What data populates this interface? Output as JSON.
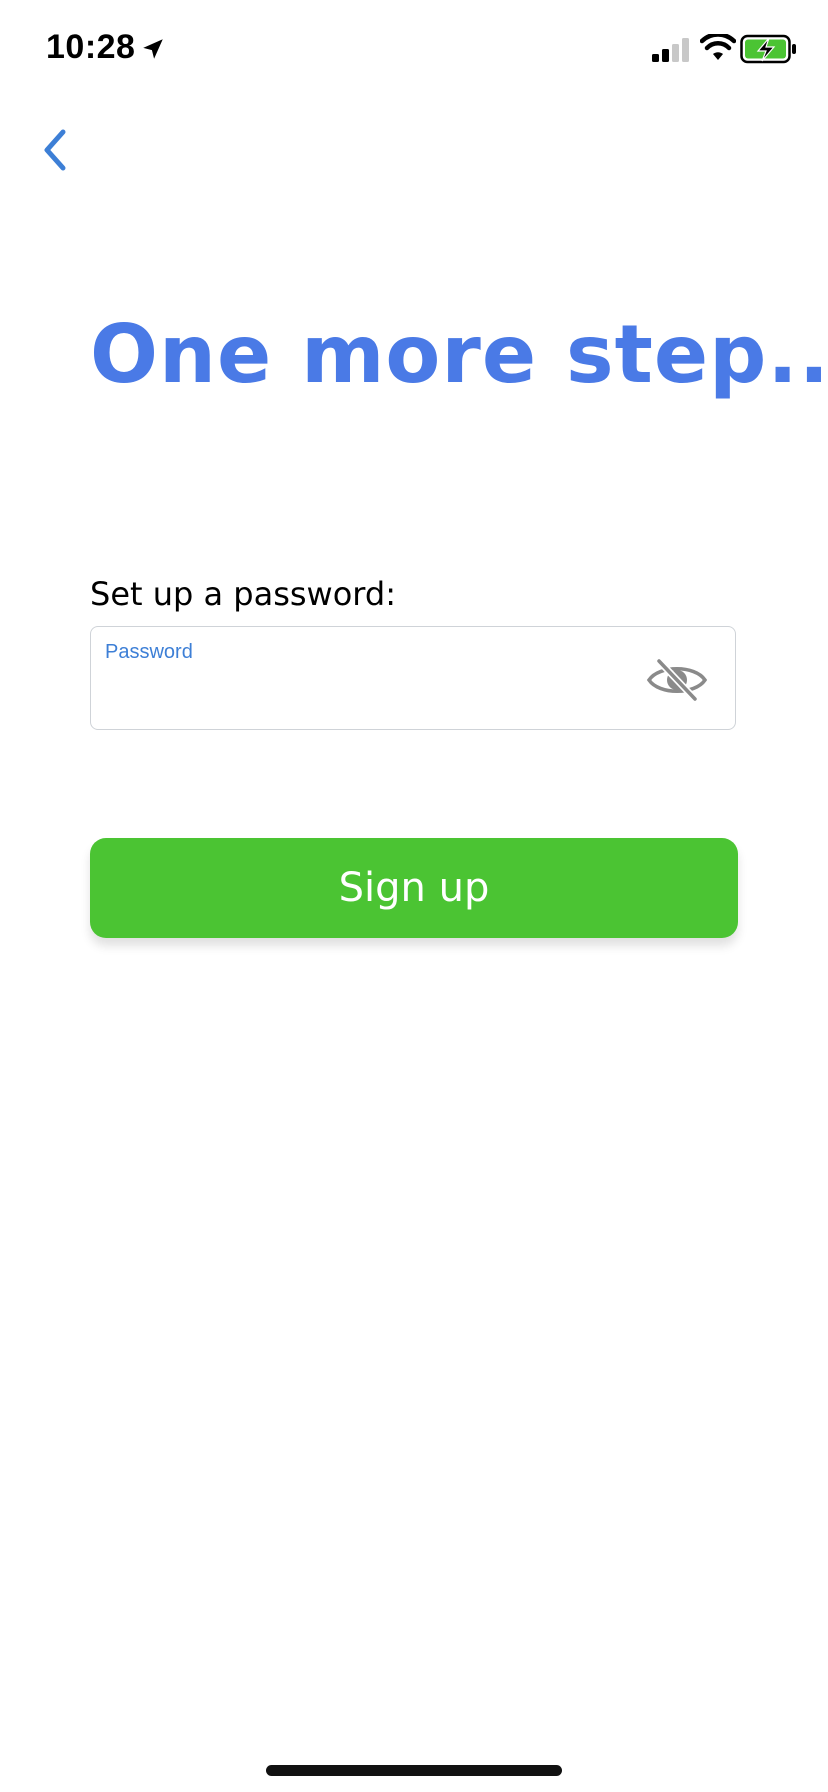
{
  "status_bar": {
    "time": "10:28",
    "location_icon": "location-arrow-icon",
    "signal_icon": "cellular-signal-icon",
    "wifi_icon": "wifi-icon",
    "battery_icon": "battery-charging-icon"
  },
  "navigation": {
    "back_icon": "chevron-left-icon"
  },
  "header": {
    "title": "One more step..."
  },
  "form": {
    "section_label": "Set up a password:",
    "password_field": {
      "label": "Password",
      "value": "",
      "placeholder": ""
    },
    "visibility_toggle_icon": "eye-off-icon",
    "submit_label": "Sign up"
  },
  "colors": {
    "accent": "#4a7ae6",
    "field_label": "#3d7fd6",
    "primary_button": "#4bc433",
    "battery_fill": "#4bc433"
  }
}
